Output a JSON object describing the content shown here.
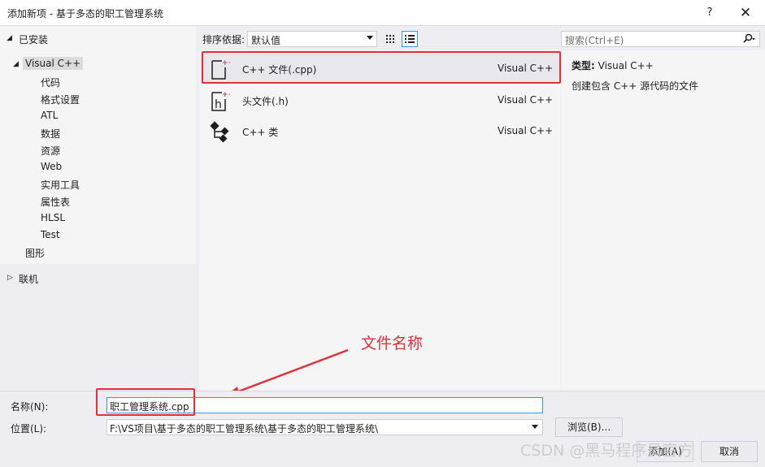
{
  "window": {
    "title": "添加新项 - 基于多态的职工管理系统",
    "help_label": "?",
    "close_label": "✕"
  },
  "sidebar": {
    "installed_label": "已安装",
    "visual_cpp_label": "Visual C++",
    "children": [
      "代码",
      "格式设置",
      "ATL",
      "数据",
      "资源",
      "Web",
      "实用工具",
      "属性表",
      "HLSL",
      "Test"
    ],
    "graphics_label": "图形",
    "online_label": "联机"
  },
  "toolbar": {
    "sort_label": "排序依据:",
    "sort_value": "默认值",
    "search_placeholder": "搜索(Ctrl+E)"
  },
  "templates": [
    {
      "name": "C++ 文件(.cpp)",
      "language": "Visual C++",
      "icon": "cpp-file-icon"
    },
    {
      "name": "头文件(.h)",
      "language": "Visual C++",
      "icon": "header-file-icon"
    },
    {
      "name": "C++ 类",
      "language": "Visual C++",
      "icon": "cpp-class-icon"
    }
  ],
  "details": {
    "type_label": "类型:",
    "type_value": "Visual C++",
    "description": "创建包含 C++ 源代码的文件"
  },
  "form": {
    "name_label": "名称(N):",
    "name_value": "职工管理系统.cpp",
    "location_label": "位置(L):",
    "location_value": "F:\\VS项目\\基于多态的职工管理系统\\基于多态的职工管理系统\\",
    "browse_label": "浏览(B)...",
    "add_label": "添加(A)",
    "cancel_label": "取消"
  },
  "annotation": {
    "text": "文件名称",
    "color": "#e0303a"
  },
  "watermark": "CSDN @黑马程序员官方"
}
